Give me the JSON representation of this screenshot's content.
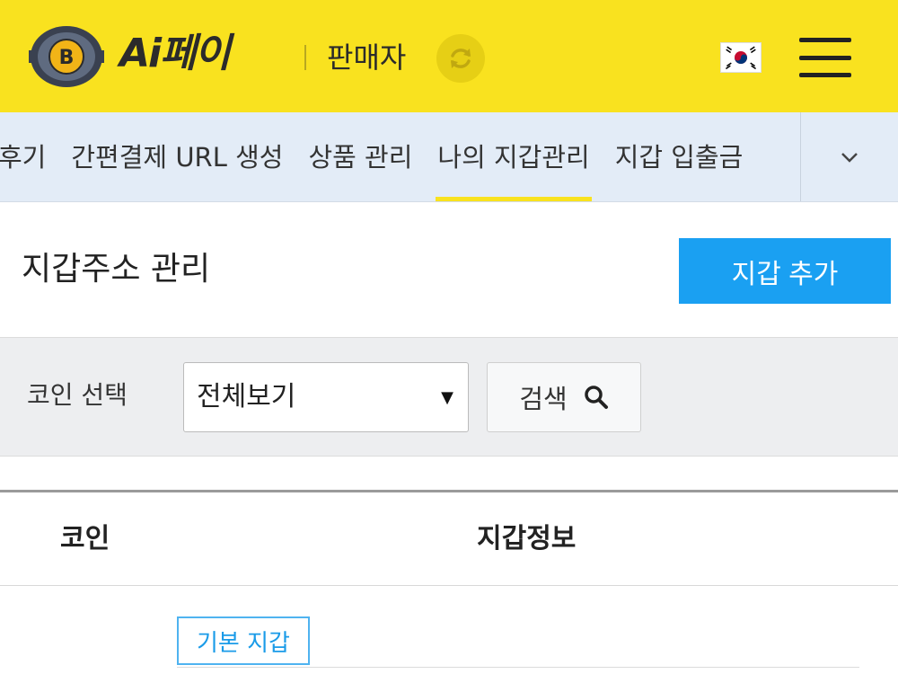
{
  "header": {
    "brand": "Ai페이",
    "role": "판매자",
    "colors": {
      "background": "#f9e21f",
      "text": "#2b2b2b"
    },
    "icons": [
      "bitcoin-logo-icon",
      "refresh-icon",
      "korea-flag-icon",
      "hamburger-menu-icon"
    ]
  },
  "nav": {
    "tabs": [
      {
        "label": "후기",
        "active": false
      },
      {
        "label": "간편결제 URL 생성",
        "active": false
      },
      {
        "label": "상품 관리",
        "active": false
      },
      {
        "label": "나의 지갑관리",
        "active": true
      },
      {
        "label": "지갑 입출금",
        "active": false
      }
    ],
    "more_icon": "chevron-down-icon",
    "colors": {
      "background": "#e3ecf7",
      "active_underline": "#f9e21f"
    }
  },
  "main": {
    "title": "지갑주소 관리",
    "add_button": "지갑 추가",
    "add_button_color": "#1aa0f2"
  },
  "filter": {
    "label": "코인 선택",
    "select_value": "전체보기",
    "search_button": "검색",
    "search_icon": "search-icon"
  },
  "table": {
    "columns": [
      "코인",
      "지갑정보"
    ],
    "rows": [
      {
        "badge": "기본 지갑"
      }
    ],
    "badge_color": "#1a9be8"
  }
}
